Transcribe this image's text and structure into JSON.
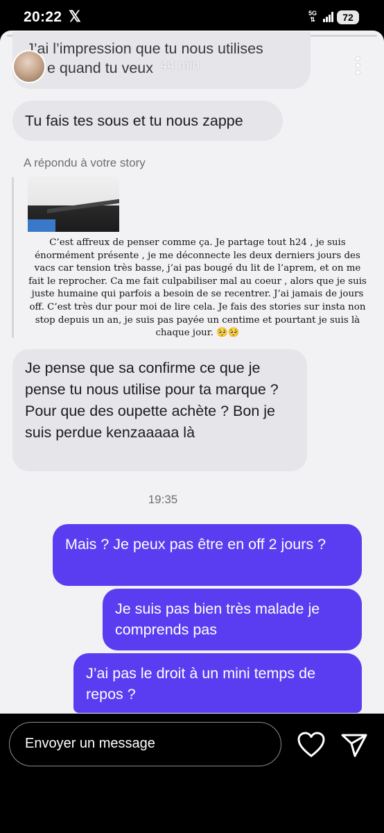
{
  "status_bar": {
    "time": "20:22",
    "x_logo": "𝕏",
    "network_top": "5G",
    "network_bottom": "⇅",
    "battery": "72"
  },
  "story_header": {
    "elapsed": "44 min",
    "avatar_icon": "user-avatar",
    "more_icon": "vertical-dots-icon"
  },
  "messages": {
    "top_bubble_line1": "J’ai l’impression que tu nous utilises",
    "top_bubble_line2": "e quand tu veux",
    "second_bubble": "Tu fais tes sous et tu nous zappe",
    "reply_label": "A répondu à votre story",
    "story_caption": "C’est affreux de penser comme ça. Je partage tout h24 , je suis énormément présente , je me déconnecte les deux derniers jours des vacs car tension très basse, j’ai pas bougé du lit de l’aprem, et on me fait le reprocher. Ca me fait culpabiliser mal au coeur , alors que je suis juste humaine qui parfois a besoin de se recentrer. J’ai jamais de jours off. C’est très dur pour moi de lire cela. Je fais des stories sur insta non stop depuis un an, je suis pas payée un centime et pourtant je suis là chaque jour. 🥺🥺",
    "third_bubble": "Je pense que sa confirme ce que je pense tu nous utilise pour ta marque ? Pour que des oupette achète ? Bon je suis perdue kenzaaaaa là",
    "time_divider": "19:35",
    "out_1": "Mais ? Je peux pas être en off 2 jours ?",
    "out_2": "Je suis pas bien très malade je comprends pas",
    "out_3": "J’ai pas le droit à un mini temps de repos ?"
  },
  "composer": {
    "placeholder": "Envoyer un message",
    "heart_icon": "heart-icon",
    "send_icon": "send-icon"
  },
  "colors": {
    "outgoing": "#5a3df0",
    "incoming": "#e5e5ea",
    "background": "#f2f2f4"
  }
}
